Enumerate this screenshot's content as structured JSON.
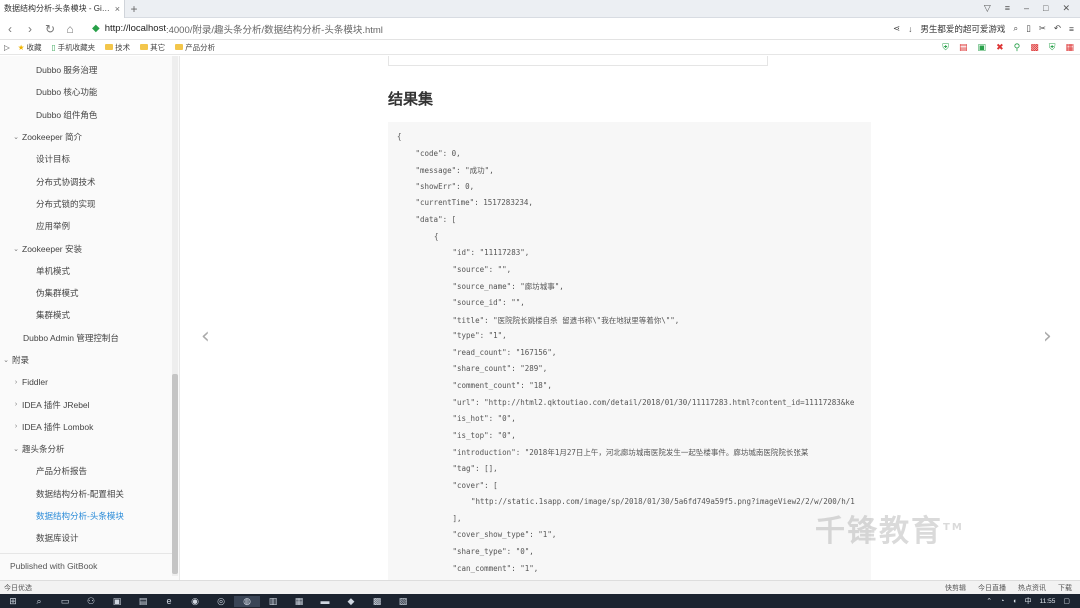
{
  "browser": {
    "tab_title": "数据结构分析-头条模块 - GitBo...",
    "tab_close": "×",
    "new_tab": "+",
    "url_host": "http://localhost",
    "url_path": ":4000/附录/趣头条分析/数据结构分析-头条模块.html",
    "promo_text": "男生都爱的超可爱游戏",
    "bookmarks": [
      "收藏",
      "手机收藏夹",
      "技术",
      "其它",
      "产品分析"
    ]
  },
  "sidebar": {
    "items": [
      {
        "label": "Dubbo 服务治理",
        "level": 2
      },
      {
        "label": "Dubbo 核心功能",
        "level": 2
      },
      {
        "label": "Dubbo 组件角色",
        "level": 2
      },
      {
        "label": "Zookeeper 简介",
        "level": 1,
        "caret": "⌄"
      },
      {
        "label": "设计目标",
        "level": 2
      },
      {
        "label": "分布式协调技术",
        "level": 2
      },
      {
        "label": "分布式锁的实现",
        "level": 2
      },
      {
        "label": "应用举例",
        "level": 2
      },
      {
        "label": "Zookeeper 安装",
        "level": 1,
        "caret": "⌄"
      },
      {
        "label": "单机模式",
        "level": 2
      },
      {
        "label": "伪集群模式",
        "level": 2
      },
      {
        "label": "集群模式",
        "level": 2
      },
      {
        "label": "Dubbo Admin 管理控制台",
        "level": 1
      },
      {
        "label": "附录",
        "level": 0,
        "caret": "⌄"
      },
      {
        "label": "Fiddler",
        "level": 1,
        "caret": "›"
      },
      {
        "label": "IDEA 插件 JRebel",
        "level": 1,
        "caret": "›"
      },
      {
        "label": "IDEA 插件 Lombok",
        "level": 1,
        "caret": "›"
      },
      {
        "label": "趣头条分析",
        "level": 1,
        "caret": "⌄"
      },
      {
        "label": "产品分析报告",
        "level": 2
      },
      {
        "label": "数据结构分析-配置相关",
        "level": 2
      },
      {
        "label": "数据结构分析-头条模块",
        "level": 2,
        "active": true
      },
      {
        "label": "数据库设计",
        "level": 2
      }
    ],
    "published": "Published with GitBook"
  },
  "main": {
    "section_title": "结果集",
    "code_lines": [
      {
        "indent": 0,
        "text": "{"
      },
      {
        "indent": 1,
        "text": "\"code\": 0,"
      },
      {
        "indent": 1,
        "text": "\"message\": \"成功\","
      },
      {
        "indent": 1,
        "text": "\"showErr\": 0,"
      },
      {
        "indent": 1,
        "text": "\"currentTime\": 1517283234,"
      },
      {
        "indent": 1,
        "text": "\"data\": ["
      },
      {
        "indent": 2,
        "text": "{"
      },
      {
        "indent": 3,
        "text": "\"id\": \"11117283\","
      },
      {
        "indent": 3,
        "text": "\"source\": \"\","
      },
      {
        "indent": 3,
        "text": "\"source_name\": \"廊坊城事\","
      },
      {
        "indent": 3,
        "text": "\"source_id\": \"\","
      },
      {
        "indent": 3,
        "text": "\"title\": \"医院院长跳楼自杀 留遗书称\\\"我在地狱里等着你\\\"\","
      },
      {
        "indent": 3,
        "text": "\"type\": \"1\","
      },
      {
        "indent": 3,
        "text": "\"read_count\": \"167156\","
      },
      {
        "indent": 3,
        "text": "\"share_count\": \"289\","
      },
      {
        "indent": 3,
        "text": "\"comment_count\": \"18\","
      },
      {
        "indent": 3,
        "text": "\"url\": \"http://html2.qktoutiao.com/detail/2018/01/30/11117283.html?content_id=11117283&ke"
      },
      {
        "indent": 3,
        "text": "\"is_hot\": \"0\","
      },
      {
        "indent": 3,
        "text": "\"is_top\": \"0\","
      },
      {
        "indent": 3,
        "text": "\"introduction\": \"2018年1月27日上午，河北廊坊城南医院发生一起坠楼事件。廊坊城南医院院长张某"
      },
      {
        "indent": 3,
        "text": "\"tag\": [],"
      },
      {
        "indent": 3,
        "text": "\"cover\": ["
      },
      {
        "indent": 4,
        "text": "\"http://static.1sapp.com/image/sp/2018/01/30/5a6fd749a59f5.png?imageView2/2/w/200/h/1"
      },
      {
        "indent": 3,
        "text": "],"
      },
      {
        "indent": 3,
        "text": "\"cover_show_type\": \"1\","
      },
      {
        "indent": 3,
        "text": "\"share_type\": \"0\","
      },
      {
        "indent": 3,
        "text": "\"can_comment\": \"1\","
      }
    ],
    "prev_arrow": "‹",
    "next_arrow": "›",
    "watermark": "千锋教育",
    "watermark_tm": "TM"
  },
  "statusbar": {
    "left": "今日优选",
    "items": [
      "快剪辑",
      "今日直播",
      "热点资讯",
      "下载"
    ]
  },
  "taskbar": {
    "clock_time": "11:55",
    "tray_lang": "中"
  }
}
